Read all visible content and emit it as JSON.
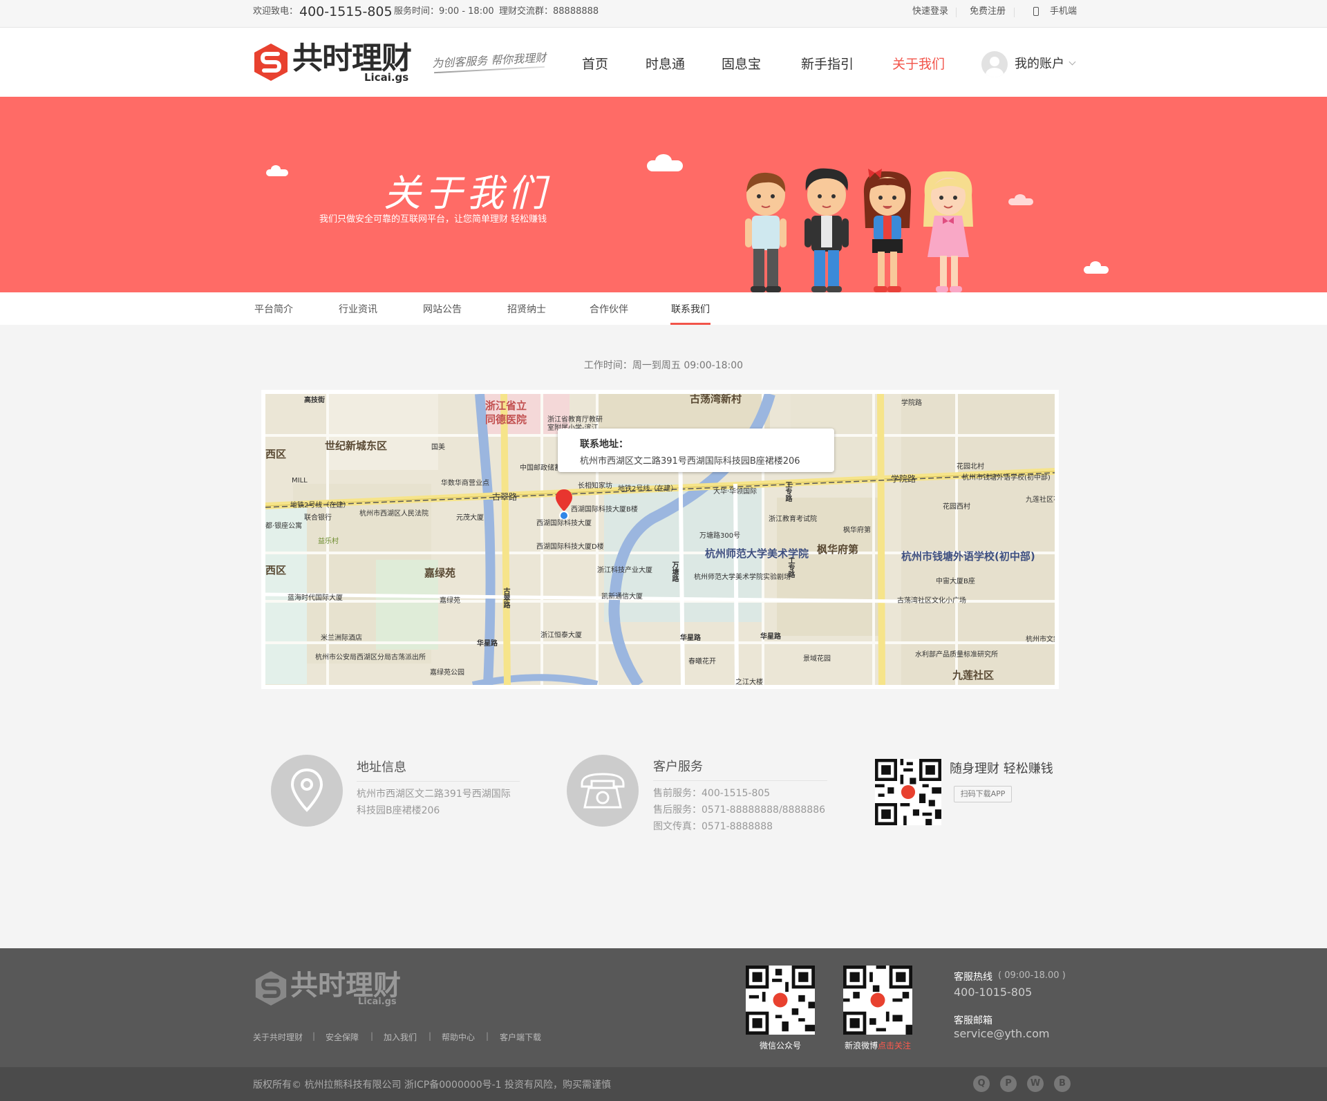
{
  "topbar": {
    "welcome": "欢迎致电：",
    "phone": "400-1515-805",
    "service_time": "服务时间：9:00 - 18:00",
    "group": "理财交流群：88888888",
    "quick_login": "快速登录",
    "register": "免费注册",
    "mobile": "手机端"
  },
  "header": {
    "logo_text": "共时理财",
    "logo_sub": "Licai.gs",
    "slogan": "为创客服务 帮你我理财",
    "nav": [
      "首页",
      "时息通",
      "固息宝",
      "新手指引",
      "关于我们"
    ],
    "account": "我的账户"
  },
  "banner": {
    "title": "关于我们",
    "subtitle": "我们只做安全可靠的互联网平台，让您简单理财 轻松赚钱"
  },
  "subnav": [
    "平台简介",
    "行业资讯",
    "网站公告",
    "招贤纳士",
    "合作伙伴",
    "联系我们"
  ],
  "work_time": "工作时间：周一到周五   09:00-18:00",
  "map": {
    "popup_title": "联系地址：",
    "popup_address": "杭州市西湖区文二路391号西湖国际科技园B座裙楼206",
    "labels": {
      "a1": "高技街",
      "a2": "浙江省立",
      "a3": "同德医院",
      "a4": "浙江省教育厅教研",
      "a5": "室附属小学-滨江",
      "a6": "古荡湾新村",
      "a7": "学院路",
      "a8": "世纪新城东区",
      "a9": "国美",
      "a10": "西区",
      "a11": "学院路",
      "a12": "花园北村",
      "a13": "中国邮政储蓄银行",
      "a14": "华数华商营业点",
      "a15": "古翠路",
      "a16": "长相知家坊",
      "a17": "地铁2号线（在建）",
      "a18": "大华·华领国际",
      "a19": "工专路",
      "a20": "杭州市钱塘外语学校(初中部)",
      "a21": "九莲社区花园南村",
      "a22": "联合银行",
      "a23": "杭州市西湖区人民法院",
      "a24": "元茂大厦",
      "a25": "西湖国际科技大厦B楼",
      "a26": "花园西村",
      "a27": "MILL",
      "a28": "西湖国际科技大厦",
      "a29": "浙江教育考试院",
      "a30": "万塘路300号",
      "a31": "枫华府第",
      "a32": "杭州师范大学美术学院",
      "a33": "枫华府第",
      "a34": "嘉绿苑",
      "a35": "西湖国际科技大厦D楼",
      "a36": "万塘路",
      "a37": "杭州市钱塘外语学校(初中部)",
      "a38": "浙江科技产业大厦",
      "a39": "杭州师范大学美术学院实验剧场",
      "a40": "中宙大厦B座",
      "a41": "蓝海时代国际大厦",
      "a42": "凯新通信大厦",
      "a43": "嘉绿苑",
      "a44": "古荡湾社区文化小广场",
      "a45": "米兰洲际酒店",
      "a46": "华星路",
      "a47": "浙江恒泰大厦",
      "a48": "华星路",
      "a49": "华星路",
      "a50": "杭州市文集团九莲",
      "a51": "杭州市公安局西湖区分局古荡派出所",
      "a52": "春曦花开",
      "a53": "景域花园",
      "a54": "水利部产品质量标准研究所",
      "a55": "嘉绿苑公园",
      "a56": "九莲社区",
      "a57": "之江大楼",
      "a58": "益乐村",
      "a59": "西区",
      "a60": "都·银座公寓",
      "a61": "地铁2号线（在建）",
      "a62": "古翠路",
      "a63": "工专路"
    }
  },
  "contact": {
    "address_title": "地址信息",
    "address_line1": "杭州市西湖区文二路391号西湖国际",
    "address_line2": "科技园B座裙楼206",
    "service_title": "客户服务",
    "presale": "售前服务：400-1515-805",
    "aftersale": "售后服务：0571-88888888/8888886",
    "fax": "图文传真：0571-8888888",
    "app_title": "随身理财 轻松赚钱",
    "app_button": "扫码下载APP"
  },
  "footer": {
    "logo_text": "共时理财",
    "logo_sub": "Licai.gs",
    "links": [
      "关于共时理财",
      "安全保障",
      "加入我们",
      "帮助中心",
      "客户端下载"
    ],
    "wechat": "微信公众号",
    "weibo": "新浪微博",
    "weibo_follow": "点击关注",
    "hotline_label": "客服热线",
    "hotline_hours": "( 09:00-18.00 )",
    "hotline": "400-1015-805",
    "email_label": "客服邮箱",
    "email": "service@yth.com",
    "copyright": "版权所有© 杭州拉熊科技有限公司  浙ICP备0000000号-1  投资有风险，购买需谨慎"
  },
  "colors": {
    "brand_red": "#ff6b66",
    "accent": "#f2544a",
    "footer_bg": "#585858"
  }
}
